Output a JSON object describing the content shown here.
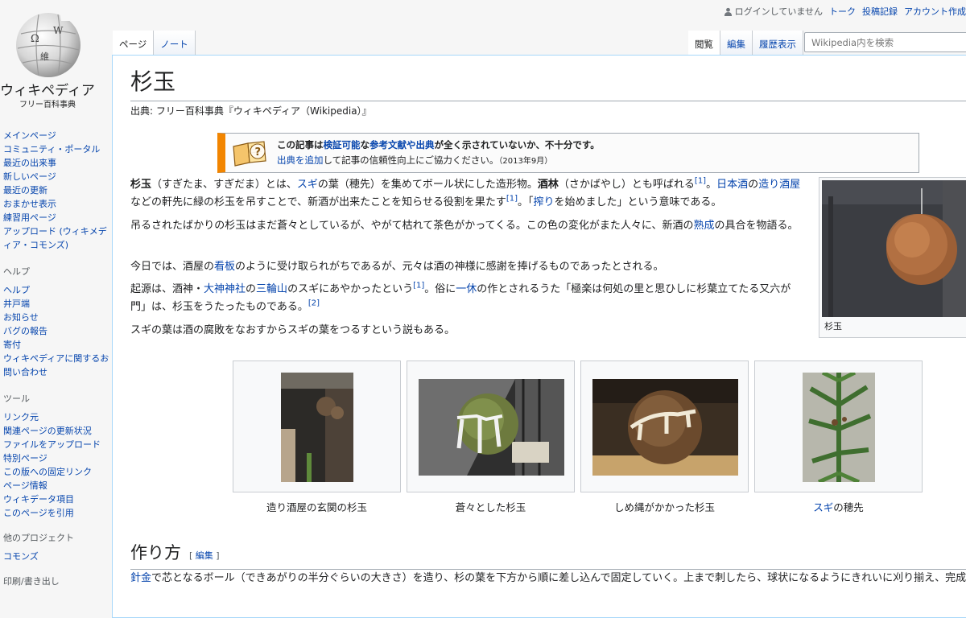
{
  "logo": {
    "wordmark": "ウィキペディア",
    "tagline": "フリー百科事典"
  },
  "sidebar": {
    "nav": [
      "メインページ",
      "コミュニティ・ポータル",
      "最近の出来事",
      "新しいページ",
      "最近の更新",
      "おまかせ表示",
      "練習用ページ",
      "アップロード (ウィキメディア・コモンズ)"
    ],
    "help_heading": "ヘルプ",
    "help": [
      "ヘルプ",
      "井戸端",
      "お知らせ",
      "バグの報告",
      "寄付",
      "ウィキペディアに関するお問い合わせ"
    ],
    "tools_heading": "ツール",
    "tools": [
      "リンク元",
      "関連ページの更新状況",
      "ファイルをアップロード",
      "特別ページ",
      "この版への固定リンク",
      "ページ情報",
      "ウィキデータ項目",
      "このページを引用"
    ],
    "projects_heading": "他のプロジェクト",
    "projects": [
      "コモンズ"
    ],
    "print_heading": "印刷/書き出し"
  },
  "personal": {
    "not_logged_in": "ログインしていません",
    "talk": "トーク",
    "contributions": "投稿記録",
    "create_account": "アカウント作成"
  },
  "tabs": {
    "page": "ページ",
    "note": "ノート",
    "read": "閲覧",
    "edit": "編集",
    "history": "履歴表示"
  },
  "search": {
    "placeholder": "Wikipedia内を検索"
  },
  "article": {
    "title": "杉玉",
    "site_sub": "出典: フリー百科事典『ウィキペディア（Wikipedia）』",
    "ambox": {
      "t1": "この記事は",
      "t2": "検証可能",
      "t3": "な",
      "t4": "参考文献や出典",
      "t5": "が全く示されていないか、不十分です。",
      "t6": "出典を追加",
      "t7": "して記事の信頼性向上にご協力ください。",
      "date": "（2013年9月）"
    },
    "p1": {
      "a1": "杉玉",
      "a2": "（すぎたま、すぎだま）とは、",
      "a3": "スギ",
      "a4": "の葉（穂先）を集めてボール状にした造形物。",
      "a5": "酒林",
      "a6": "（さかばやし）とも呼ばれる",
      "a7": "[1]",
      "a8": "。",
      "a9": "日本酒",
      "a10": "の",
      "a11": "造り酒屋",
      "a12": "などの軒先に緑の杉玉を吊すことで、新酒が出来たことを知らせる役割を果たす",
      "a13": "[1]",
      "a14": "。「",
      "a15": "搾り",
      "a16": "を始めました」という意味である。"
    },
    "p2": {
      "a1": "吊るされたばかりの杉玉はまだ蒼々としているが、やがて枯れて茶色がかってくる。この色の変化がまた人々に、新酒の",
      "a2": "熟成",
      "a3": "の具合を物語る。"
    },
    "p3": {
      "a1": "今日では、酒屋の",
      "a2": "看板",
      "a3": "のように受け取られがちであるが、元々は酒の神様に感謝を捧げるものであったとされる。"
    },
    "p4": {
      "a1": "起源は、酒神・",
      "a2": "大神神社",
      "a3": "の",
      "a4": "三輪山",
      "a5": "のスギにあやかったという",
      "a6": "[1]",
      "a7": "。俗に",
      "a8": "一休",
      "a9": "の作とされるうた「極楽は何処の里と思ひしに杉葉立てたる又六が門」は、杉玉をうたったものである。",
      "a10": "[2]"
    },
    "p5": "スギの葉は酒の腐敗をなおすからスギの葉をつるすという説もある。",
    "thumb_caption": "杉玉",
    "gallery": [
      {
        "caption": "造り酒屋の玄関の杉玉"
      },
      {
        "caption": "蒼々とした杉玉"
      },
      {
        "caption": "しめ縄がかかった杉玉"
      },
      {
        "caption_link": "スギ",
        "caption_rest": "の穂先"
      }
    ],
    "section": {
      "title": "作り方",
      "edit_open": "[ ",
      "edit": "編集",
      "edit_close": " ]",
      "p_link": "針金",
      "p_rest": "で芯となるボール（できあがりの半分ぐらいの大きさ）を造り、杉の葉を下方から順に差し込んで固定していく。上まで刺したら、球状になるようにきれいに刈り揃え、完成。"
    }
  }
}
